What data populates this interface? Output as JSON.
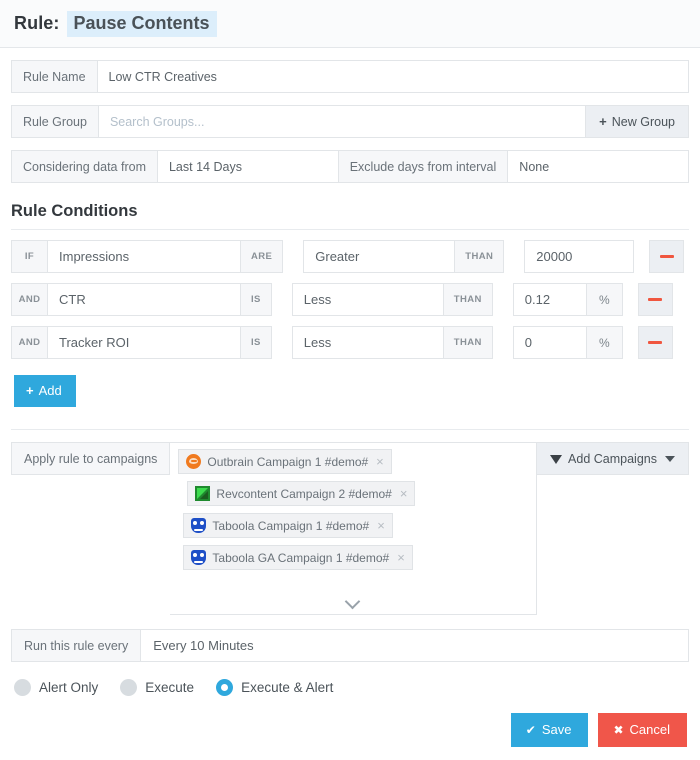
{
  "header": {
    "label": "Rule:",
    "value": "Pause Contents"
  },
  "form": {
    "rule_name": {
      "label": "Rule Name",
      "value": "Low CTR Creatives"
    },
    "rule_group": {
      "label": "Rule Group",
      "placeholder": "Search Groups...",
      "value": "",
      "new_group_button": "New Group",
      "plus": "+"
    },
    "considering": {
      "label": "Considering data from",
      "value": "Last 14 Days"
    },
    "exclude": {
      "label": "Exclude days from interval",
      "value": "None"
    }
  },
  "conditions": {
    "title": "Rule Conditions",
    "add_button": "Add",
    "add_plus": "+",
    "rows": [
      {
        "conj": "IF",
        "field": "Impressions",
        "mid": "ARE",
        "operator": "Greater",
        "than": "THAN",
        "value": "20000",
        "unit": "",
        "has_unit": false
      },
      {
        "conj": "AND",
        "field": "CTR",
        "mid": "IS",
        "operator": "Less",
        "than": "THAN",
        "value": "0.12",
        "unit": "%",
        "has_unit": true
      },
      {
        "conj": "AND",
        "field": "Tracker ROI",
        "mid": "IS",
        "operator": "Less",
        "than": "THAN",
        "value": "0",
        "unit": "%",
        "has_unit": true
      }
    ]
  },
  "campaigns": {
    "label": "Apply rule to campaigns",
    "add_button": "Add Campaigns",
    "tags": [
      {
        "icon": "outbrain-icon",
        "name": "Outbrain Campaign 1 #demo#",
        "remove": "×",
        "indent": 0
      },
      {
        "icon": "revcontent-icon",
        "name": "Revcontent Campaign 2 #demo#",
        "remove": "×",
        "indent": 9
      },
      {
        "icon": "taboola-icon",
        "name": "Taboola Campaign 1 #demo#",
        "remove": "×",
        "indent": 5
      },
      {
        "icon": "taboola-icon",
        "name": "Taboola GA Campaign 1 #demo#",
        "remove": "×",
        "indent": 5
      }
    ]
  },
  "schedule": {
    "label": "Run this rule every",
    "value": "Every 10 Minutes"
  },
  "modes": [
    {
      "label": "Alert Only",
      "selected": false
    },
    {
      "label": "Execute",
      "selected": false
    },
    {
      "label": "Execute & Alert",
      "selected": true
    }
  ],
  "footer": {
    "save": "Save",
    "save_glyph": "✔",
    "cancel": "Cancel",
    "cancel_glyph": "✖"
  },
  "colors": {
    "accent": "#2fa8dd",
    "danger": "#f0564a",
    "remove": "#f0563f",
    "highlight": "#dceefb",
    "addon_bg": "#f6f7f9",
    "border": "#e2e5e8"
  }
}
